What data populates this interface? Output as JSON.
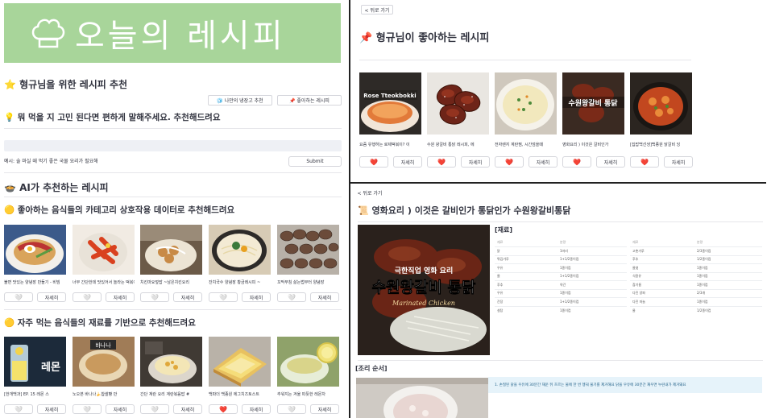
{
  "left": {
    "banner_title": "오늘의 레시피",
    "reco_title": "⭐ 형규님을 위한 레시피 추천",
    "btn_fridge": "🧊 나만의 냉장고 추천",
    "btn_liked": "📌 좋아하는 레시피",
    "ask_title": "💡 뭐 먹을 지 고민 된다면 편하게 말해주세요. 추천해드려요",
    "hint": "예시: 술 마실 때 먹기 좋은 국물 요리가 필요해",
    "submit": "Submit",
    "ai_title": "🍲 AI가 추천하는 레시피",
    "cat_title": "🟡 좋아하는 음식들의 카테고리 상호작용 데이터로 추천해드려요",
    "cat_cards": [
      {
        "caption": "불면 맛있는 양념장 만들기 - 비빔",
        "heart": "🤍",
        "detail": "자세히",
        "liked": false
      },
      {
        "caption": "너무 간단한데 맛있어서 놀라는 떡볶이",
        "heart": "🤍",
        "detail": "자세히",
        "liked": false
      },
      {
        "caption": "치킨마요덮밥 ~남은치킨요리",
        "heart": "🤍",
        "detail": "자세히",
        "liked": false
      },
      {
        "caption": "잔치국수 양념장 황금레시피 ~",
        "heart": "🤍",
        "detail": "자세히",
        "liked": false
      },
      {
        "caption": "꼬막무침 삶는법부터 양념장",
        "heart": "🤍",
        "detail": "자세히",
        "liked": false
      }
    ],
    "ing_title": "🟡 자주 먹는 음식들의 재료를 기반으로 추천해드려요",
    "ing_cards": [
      {
        "caption": "[한개백과] EP. 15 레몬 스",
        "heart": "🤍",
        "detail": "자세히",
        "liked": false
      },
      {
        "caption": "노오븐 바나나🍌찹쌀빵 만",
        "heart": "🤍",
        "detail": "자세히",
        "liked": false
      },
      {
        "caption": "간단 계란 요리 계란볶음밥 #",
        "heart": "🤍",
        "detail": "자세히",
        "liked": false
      },
      {
        "caption": "백파더 백종원 에그치즈토스트",
        "heart": "❤️",
        "detail": "자세히",
        "liked": true
      },
      {
        "caption": "추워지는 겨울 따뜻한 레몬차",
        "heart": "🤍",
        "detail": "자세히",
        "liked": false
      }
    ],
    "image_texts": {
      "lemon": "레몬",
      "banana": "바나나"
    }
  },
  "right_top": {
    "back": "< 뒤로 가기",
    "title": "📌 형규님이 좋아하는 레시피",
    "cards": [
      {
        "caption": "요즘 유행하는 로제떡볶이? 이",
        "heart": "❤️",
        "detail": "자세히"
      },
      {
        "caption": "수원 왕갈비 통닭 레시피, 에",
        "heart": "❤️",
        "detail": "자세히"
      },
      {
        "caption": "전자렌지 계란찜, 시간엄을때",
        "heart": "❤️",
        "detail": "자세히"
      },
      {
        "caption": "영화요리 ) 이것은 갈비인가",
        "heart": "❤️",
        "detail": "자세히"
      },
      {
        "caption": "[집밥백선생]백종원 닭갈비 잉",
        "heart": "❤️",
        "detail": "자세히"
      }
    ],
    "image_texts": {
      "rose": "Rose Tteokbokki",
      "galbi": "수원왕갈비 통닭"
    }
  },
  "right_bot": {
    "back": "< 뒤로 가기",
    "title": "📜 영화요리 ) 이것은 갈비인가 통닭인가 수원왕갈비통닭",
    "image_top": "극한직업 영화 요리",
    "image_main": "수원왕갈비 통닭",
    "image_sub": "Marinated Chicken",
    "ingredients_label": "[재료]",
    "table_headers": {
      "name": "재료",
      "amount": "분량"
    },
    "ingredients_left": [
      {
        "name": "닭",
        "amount": "1마리"
      },
      {
        "name": "튀김가루",
        "amount": "1+1/2종이컵"
      },
      {
        "name": "우유",
        "amount": "1종이컵"
      },
      {
        "name": "물",
        "amount": "1+1/2종이컵"
      },
      {
        "name": "후추",
        "amount": "약간"
      },
      {
        "name": "우유",
        "amount": "1종이컵"
      },
      {
        "name": "간장",
        "amount": "1+1/2종이컵"
      },
      {
        "name": "설탕",
        "amount": "1종이컵"
      }
    ],
    "ingredients_right": [
      {
        "name": "고춧가루",
        "amount": "2/3종이컵"
      },
      {
        "name": "후추",
        "amount": "1/2종이컵"
      },
      {
        "name": "물엿",
        "amount": "1종이컵"
      },
      {
        "name": "식용유",
        "amount": "1종이컵"
      },
      {
        "name": "참기름",
        "amount": "1종이컵"
      },
      {
        "name": "다진 양파",
        "amount": "2/3개"
      },
      {
        "name": "다진 마늘",
        "amount": "1종이컵"
      },
      {
        "name": "물",
        "amount": "1/2종이컵"
      }
    ],
    "steps_label": "[조리 순서]",
    "step1": "1.  손질된 닭을 우유에 30분간 재운 뒤 흐르는 물에 한 번 헹궈 물기를 제거해요 닭을 우유에 30분간 재우면 누린내가 제거돼요"
  },
  "colors": {
    "banner": "#a8d59a",
    "heart_red": "#e0203a",
    "step_bg": "#e6f3fa"
  }
}
